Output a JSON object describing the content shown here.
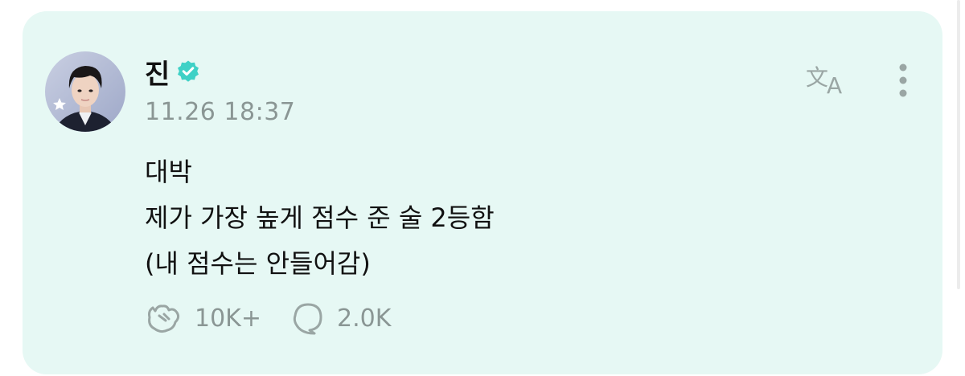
{
  "post": {
    "author_name": "진",
    "timestamp": "11.26 18:37",
    "body_lines": [
      "대박",
      "제가 가장 높게 점수 준 술 2등함",
      "(내 점수는 안들어감)"
    ],
    "likes_count": "10K+",
    "comments_count": "2.0K"
  },
  "icons": {
    "verified": "verified-badge-icon",
    "translate": "translate-icon",
    "more": "more-vertical-icon",
    "like": "like-icon",
    "comment": "comment-icon"
  },
  "colors": {
    "card_background": "#e6f8f4",
    "accent": "#3fd1c6",
    "muted_text": "#8a9694",
    "icon_gray": "#9aa6a4"
  }
}
